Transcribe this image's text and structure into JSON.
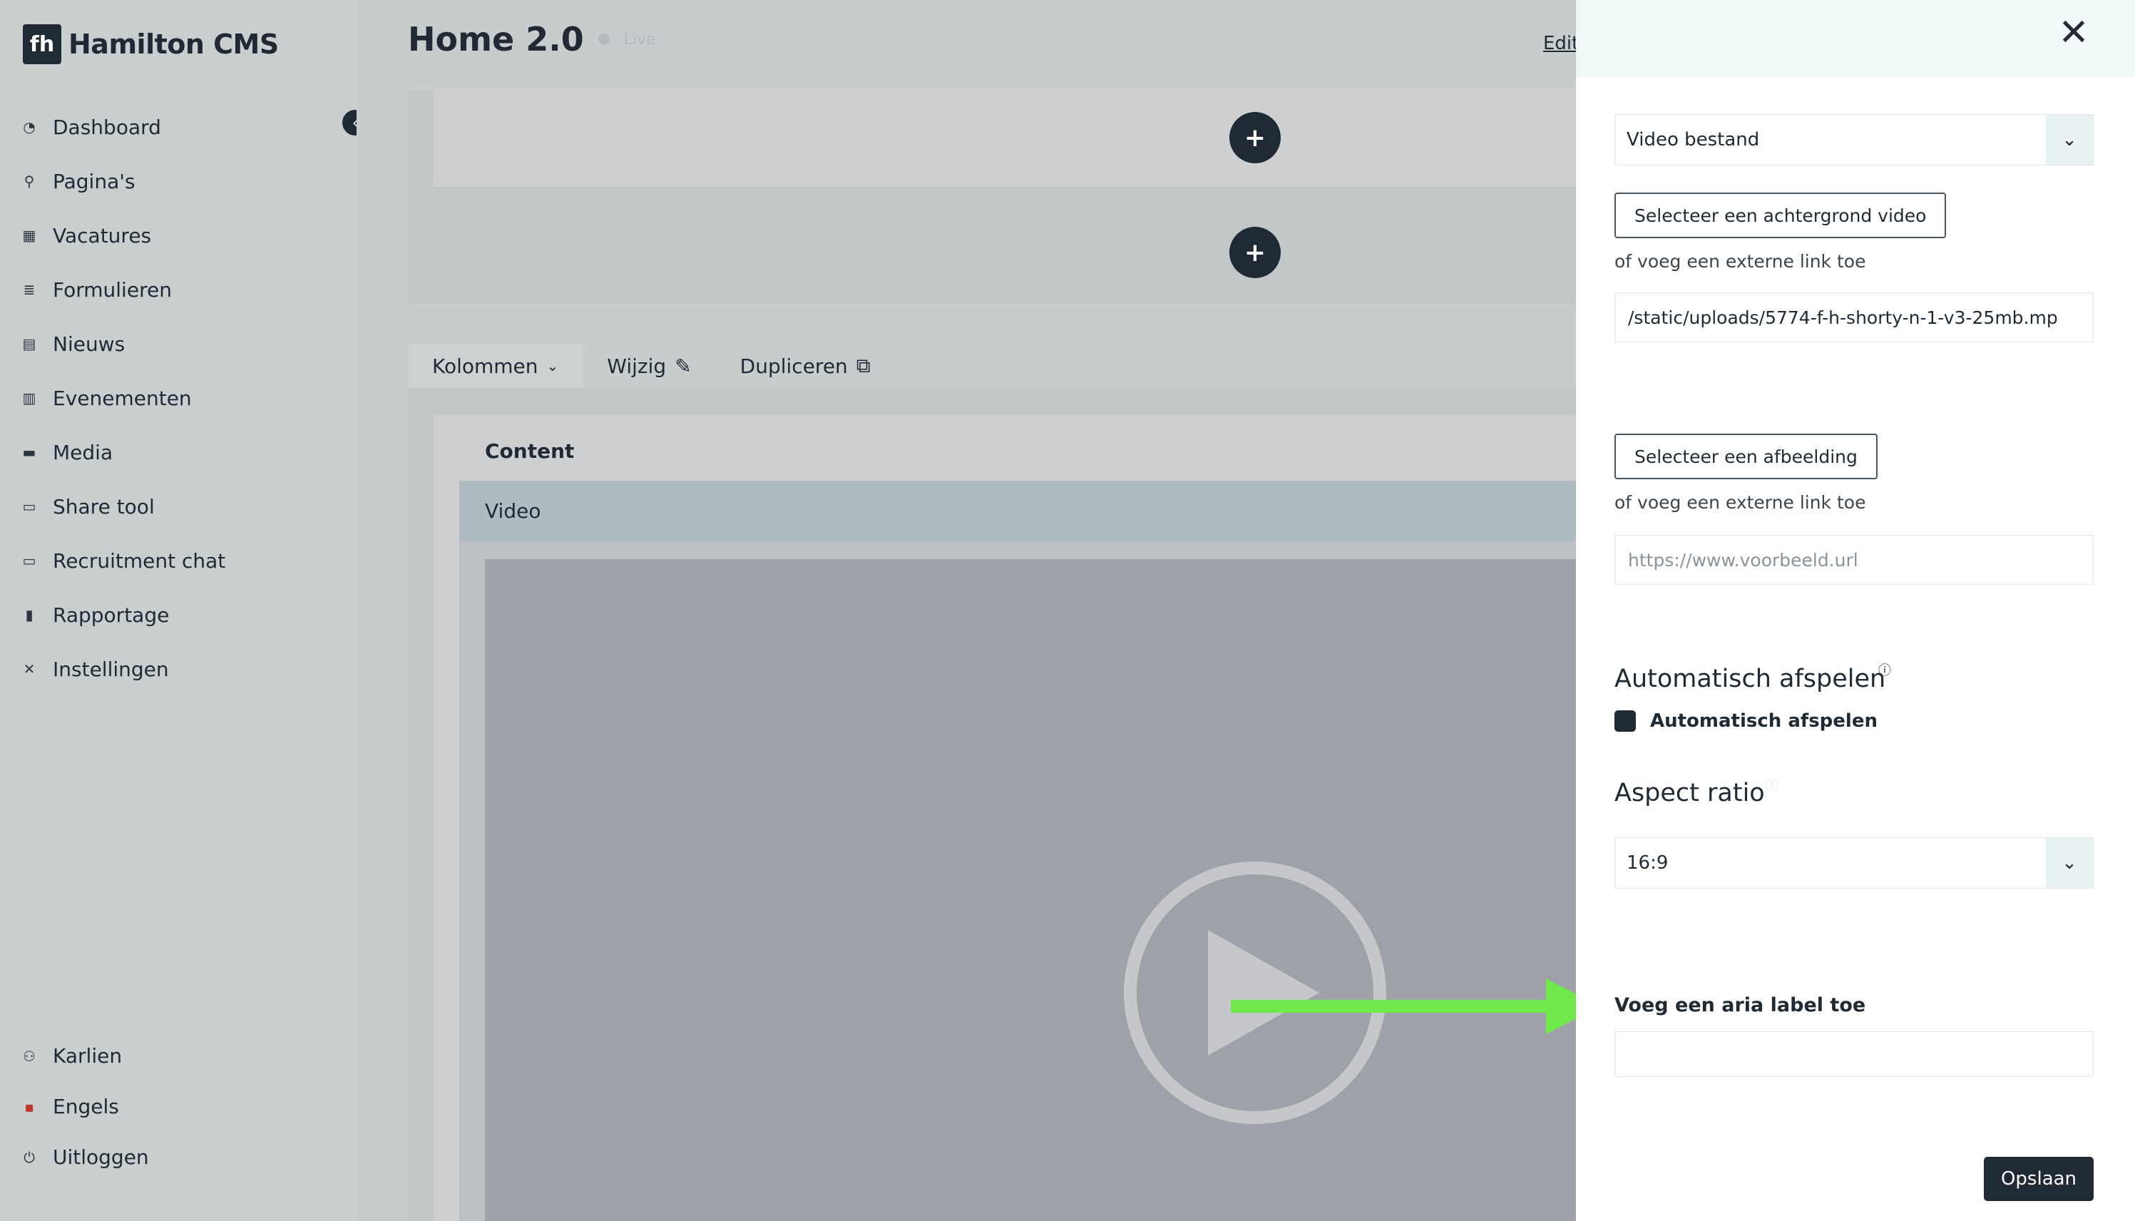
{
  "app": {
    "logo_mark": "fh",
    "logo_text": "Hamilton CMS"
  },
  "sidebar": {
    "items": [
      {
        "label": "Dashboard",
        "icon": "gauge-icon"
      },
      {
        "label": "Pagina's",
        "icon": "sitemap-icon"
      },
      {
        "label": "Vacatures",
        "icon": "grid-icon"
      },
      {
        "label": "Formulieren",
        "icon": "list-icon"
      },
      {
        "label": "Nieuws",
        "icon": "newspaper-icon"
      },
      {
        "label": "Evenementen",
        "icon": "calendar-icon"
      },
      {
        "label": "Media",
        "icon": "folder-icon"
      },
      {
        "label": "Share tool",
        "icon": "comment-icon"
      },
      {
        "label": "Recruitment chat",
        "icon": "chat-icon"
      },
      {
        "label": "Rapportage",
        "icon": "bar-chart-icon"
      },
      {
        "label": "Instellingen",
        "icon": "tools-icon"
      }
    ],
    "bottom": [
      {
        "label": "Karlien",
        "icon": "user-icon"
      },
      {
        "label": "Engels",
        "icon": "flag-icon"
      },
      {
        "label": "Uitloggen",
        "icon": "power-icon"
      }
    ]
  },
  "header": {
    "title": "Home 2.0",
    "status": "Live",
    "edit_link": "Edit"
  },
  "toolbar": {
    "columns_label": "Kolommen",
    "edit_label": "Wijzig",
    "duplicate_label": "Dupliceren"
  },
  "content": {
    "section_label": "Content",
    "block_label": "Video"
  },
  "panel": {
    "video_type": "Video bestand",
    "select_video_button": "Selecteer een achtergrond video",
    "external_link_hint_1": "of voeg een externe link toe",
    "video_url": "/static/uploads/5774-f-h-shorty-n-1-v3-25mb.mp",
    "select_image_button": "Selecteer een afbeelding",
    "external_link_hint_2": "of voeg een externe link toe",
    "image_url_placeholder": "https://www.voorbeeld.url",
    "autoplay_title": "Automatisch afspelen",
    "autoplay_checkbox_label": "Automatisch afspelen",
    "aspect_title": "Aspect ratio",
    "aspect_value": "16:9",
    "aria_label_title": "Voeg een aria label toe",
    "save_button": "Opslaan"
  },
  "colors": {
    "brand_dark": "#1f2a35",
    "annotation_arrow": "#6ee84a",
    "panel_header": "#f1f8f8"
  }
}
